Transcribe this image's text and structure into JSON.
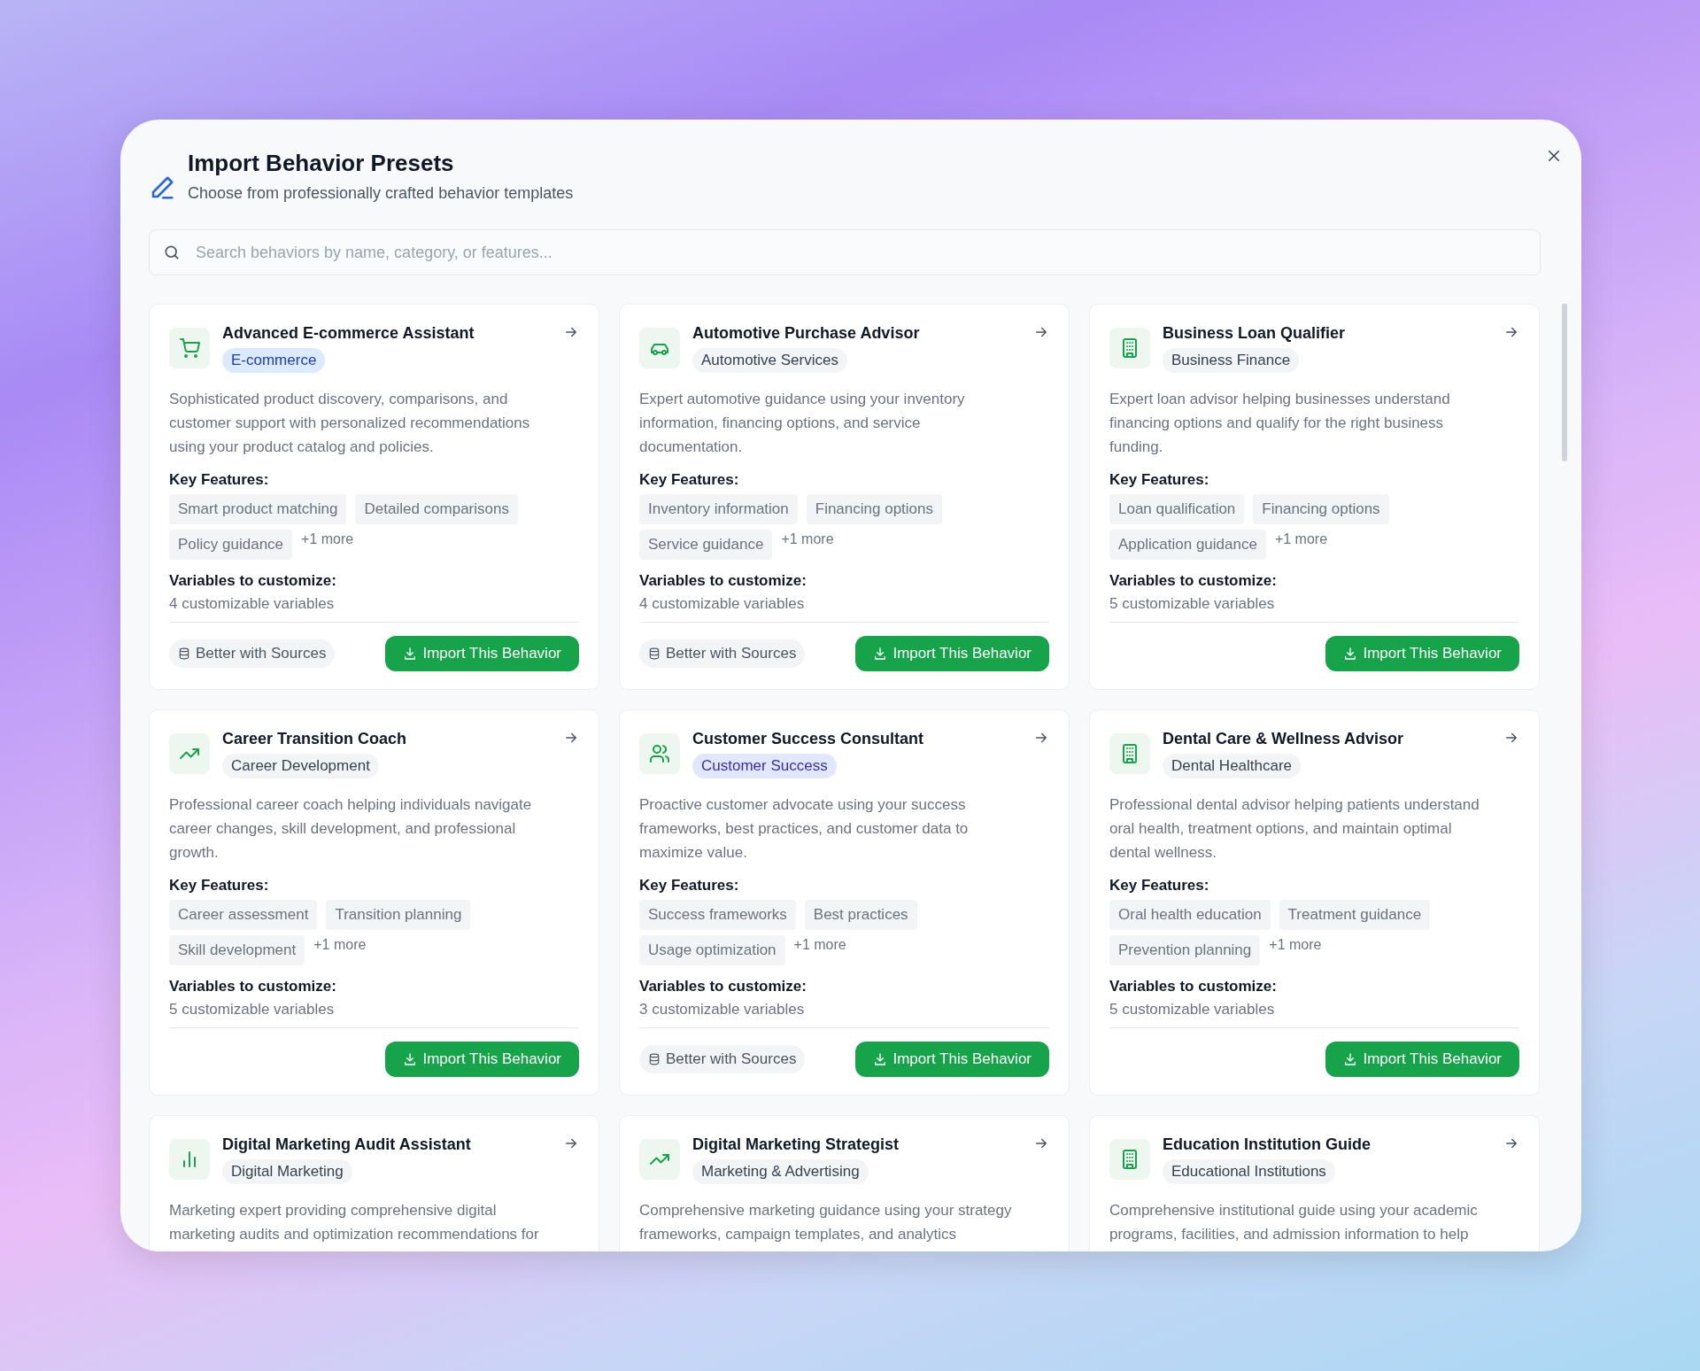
{
  "dialog": {
    "title": "Import Behavior Presets",
    "subtitle": "Choose from professionally crafted behavior templates"
  },
  "search": {
    "placeholder": "Search behaviors by name, category, or features..."
  },
  "presets": [
    {
      "kind": "cart",
      "title": "Advanced E-commerce Assistant",
      "category": "E-commerce",
      "color": "#1e40af",
      "description": "Sophisticated product discovery, comparisons, and customer support with personalized recommendations using your product catalog and policies.",
      "features_label": "Key Features:",
      "features": [
        "Smart product matching",
        "Detailed comparisons",
        "Policy guidance"
      ],
      "more": "+1 more",
      "variables_label": "Variables to customize:",
      "variables": "4 customizable variables",
      "sources": "Better with Sources",
      "import": "Import This Behavior"
    },
    {
      "kind": "car",
      "title": "Automotive Purchase Advisor",
      "category": "Automotive Services",
      "color": "#374151",
      "description": "Expert automotive guidance using your inventory information, financing options, and service documentation.",
      "features_label": "Key Features:",
      "features": [
        "Inventory information",
        "Financing options",
        "Service guidance"
      ],
      "more": "+1 more",
      "variables_label": "Variables to customize:",
      "variables": "4 customizable variables",
      "sources": "Better with Sources",
      "import": "Import This Behavior"
    },
    {
      "kind": "building",
      "title": "Business Loan Qualifier",
      "category": "Business Finance",
      "color": "#374151",
      "description": "Expert loan advisor helping businesses understand financing options and qualify for the right business funding.",
      "features_label": "Key Features:",
      "features": [
        "Loan qualification",
        "Financing options",
        "Application guidance"
      ],
      "more": "+1 more",
      "variables_label": "Variables to customize:",
      "variables": "5 customizable variables",
      "import": "Import This Behavior"
    },
    {
      "kind": "trend",
      "title": "Career Transition Coach",
      "category": "Career Development",
      "color": "#374151",
      "description": "Professional career coach helping individuals navigate career changes, skill development, and professional growth.",
      "features_label": "Key Features:",
      "features": [
        "Career assessment",
        "Transition planning",
        "Skill development"
      ],
      "more": "+1 more",
      "variables_label": "Variables to customize:",
      "variables": "5 customizable variables",
      "import": "Import This Behavior"
    },
    {
      "kind": "users",
      "title": "Customer Success Consultant",
      "category": "Customer Success",
      "color": "#3730a3",
      "description": "Proactive customer advocate using your success frameworks, best practices, and customer data to maximize value.",
      "features_label": "Key Features:",
      "features": [
        "Success frameworks",
        "Best practices",
        "Usage optimization"
      ],
      "more": "+1 more",
      "variables_label": "Variables to customize:",
      "variables": "3 customizable variables",
      "sources": "Better with Sources",
      "import": "Import This Behavior"
    },
    {
      "kind": "building",
      "title": "Dental Care & Wellness Advisor",
      "category": "Dental Healthcare",
      "color": "#374151",
      "description": "Professional dental advisor helping patients understand oral health, treatment options, and maintain optimal dental wellness.",
      "features_label": "Key Features:",
      "features": [
        "Oral health education",
        "Treatment guidance",
        "Prevention planning"
      ],
      "more": "+1 more",
      "variables_label": "Variables to customize:",
      "variables": "5 customizable variables",
      "import": "Import This Behavior"
    },
    {
      "kind": "chart",
      "title": "Digital Marketing Audit Assistant",
      "category": "Digital Marketing",
      "color": "#374151",
      "description": "Marketing expert providing comprehensive digital marketing audits and optimization recommendations for"
    },
    {
      "kind": "trend",
      "title": "Digital Marketing Strategist",
      "category": "Marketing & Advertising",
      "color": "#374151",
      "description": "Comprehensive marketing guidance using your strategy frameworks, campaign templates, and analytics"
    },
    {
      "kind": "building",
      "title": "Education Institution Guide",
      "category": "Educational Institutions",
      "color": "#374151",
      "description": "Comprehensive institutional guide using your academic programs, facilities, and admission information to help"
    }
  ]
}
